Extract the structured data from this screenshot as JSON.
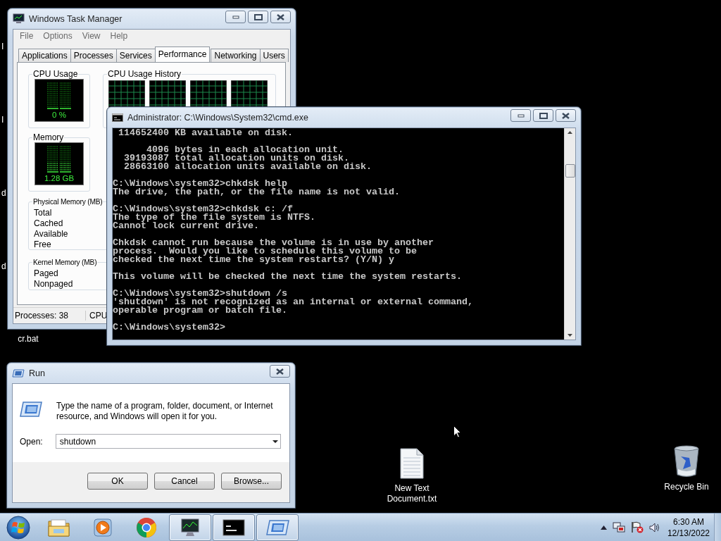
{
  "desktop": {
    "edge_labels": [
      "I",
      "I",
      "d",
      "d"
    ],
    "icons": [
      {
        "kind": "label-only",
        "label": "cr.bat"
      },
      {
        "kind": "text-file",
        "label": "New Text Document.txt"
      },
      {
        "kind": "recycle-bin",
        "label": "Recycle Bin"
      }
    ]
  },
  "task_manager": {
    "title": "Windows Task Manager",
    "menu": [
      "File",
      "Options",
      "View",
      "Help"
    ],
    "tabs": [
      {
        "label": "Applications",
        "selected": false
      },
      {
        "label": "Processes",
        "selected": false
      },
      {
        "label": "Services",
        "selected": false
      },
      {
        "label": "Performance",
        "selected": true
      },
      {
        "label": "Networking",
        "selected": false
      },
      {
        "label": "Users",
        "selected": false
      }
    ],
    "cpu_usage": {
      "label": "CPU Usage",
      "reading": "0 %"
    },
    "cpu_history": {
      "label": "CPU Usage History"
    },
    "memory": {
      "label": "Memory",
      "reading": "1.28 GB"
    },
    "physical_memory": {
      "label": "Physical Memory (MB)",
      "rows": [
        "Total",
        "Cached",
        "Available",
        "Free"
      ]
    },
    "kernel_memory": {
      "label": "Kernel Memory (MB)",
      "rows": [
        "Paged",
        "Nonpaged"
      ]
    },
    "status_bar": [
      "Processes: 38",
      "CPU"
    ]
  },
  "console": {
    "title": "Administrator: C:\\Windows\\System32\\cmd.exe",
    "blocks": [
      [
        " 114652400 KB available on disk."
      ],
      [
        "      4096 bytes in each allocation unit.",
        "  39193087 total allocation units on disk.",
        "  28663100 allocation units available on disk."
      ],
      [
        "C:\\Windows\\system32>chkdsk help",
        "The drive, the path, or the file name is not valid."
      ],
      [
        "C:\\Windows\\system32>chkdsk c: /f",
        "The type of the file system is NTFS.",
        "Cannot lock current drive."
      ],
      [
        "Chkdsk cannot run because the volume is in use by another",
        "process.  Would you like to schedule this volume to be",
        "checked the next time the system restarts? (Y/N) y"
      ],
      [
        "This volume will be checked the next time the system restarts."
      ],
      [
        "C:\\Windows\\system32>shutdown /s",
        "'shutdown' is not recognized as an internal or external command,",
        "operable program or batch file."
      ],
      [
        "C:\\Windows\\system32>"
      ]
    ]
  },
  "run_dialog": {
    "title": "Run",
    "description": "Type the name of a program, folder, document, or Internet resource, and Windows will open it for you.",
    "open_label": "Open:",
    "open_value": "shutdown",
    "buttons": [
      "OK",
      "Cancel",
      "Browse..."
    ]
  },
  "taskbar": {
    "items": [
      {
        "kind": "folder",
        "running": false
      },
      {
        "kind": "media",
        "running": false
      },
      {
        "kind": "browser",
        "running": false
      },
      {
        "kind": "monitor",
        "running": true
      },
      {
        "kind": "console",
        "running": true
      },
      {
        "kind": "run",
        "running": true
      }
    ],
    "tray": [
      {
        "kind": "arrow"
      },
      {
        "kind": "network"
      },
      {
        "kind": "flag"
      },
      {
        "kind": "speaker"
      }
    ],
    "clock": {
      "time": "6:30 AM",
      "date": "12/13/2022"
    }
  }
}
